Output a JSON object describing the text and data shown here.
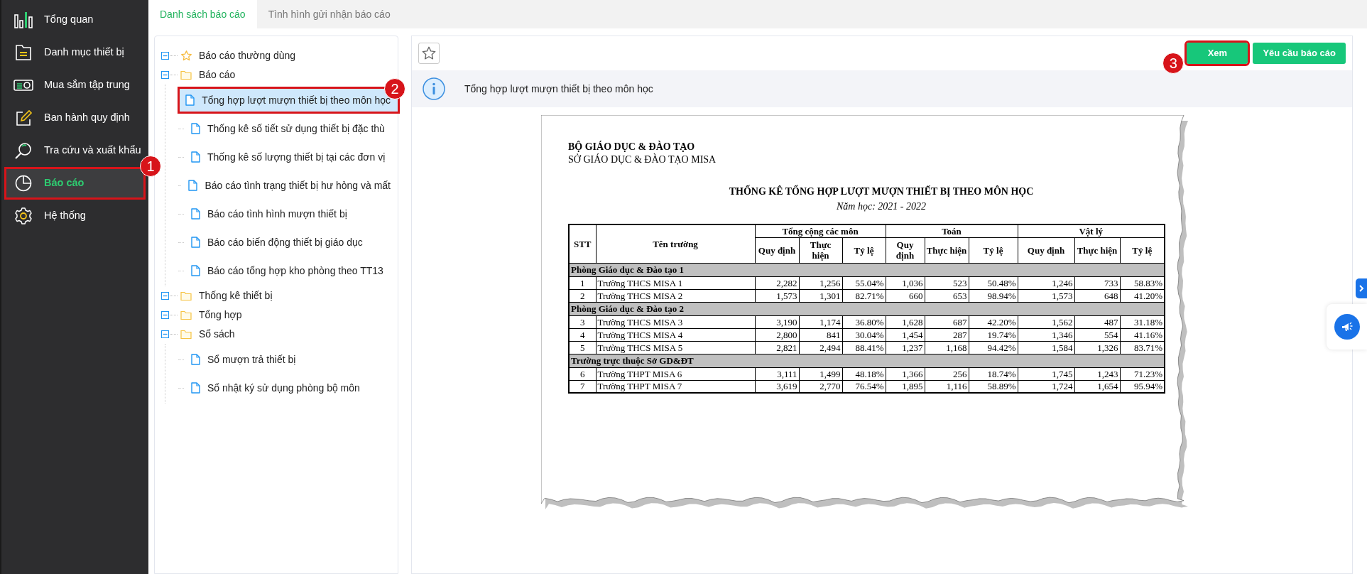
{
  "sidebar": {
    "items": [
      {
        "label": "Tổng quan",
        "selected": false
      },
      {
        "label": "Danh mục thiết bị",
        "selected": false
      },
      {
        "label": "Mua sắm tập trung",
        "selected": false
      },
      {
        "label": "Ban hành quy định",
        "selected": false
      },
      {
        "label": "Tra cứu và xuất khẩu",
        "selected": false
      },
      {
        "label": "Báo cáo",
        "selected": true,
        "callout": "1"
      },
      {
        "label": "Hệ thống",
        "selected": false
      }
    ]
  },
  "tabs": [
    {
      "label": "Danh sách báo cáo",
      "selected": true
    },
    {
      "label": "Tình hình gửi nhận báo cáo",
      "selected": false
    }
  ],
  "tree": [
    {
      "label": "Báo cáo thường dùng",
      "kind": "favorites",
      "expanded": true
    },
    {
      "label": "Báo cáo",
      "kind": "folder",
      "expanded": true,
      "children": [
        {
          "label": "Tổng hợp lượt mượn thiết bị theo môn học",
          "selected": true,
          "callout": "2"
        },
        {
          "label": "Thống kê số tiết sử dụng thiết bị đặc thù",
          "selected": false
        },
        {
          "label": "Thống kê số lượng thiết bị tại các đơn vị",
          "selected": false
        },
        {
          "label": "Báo cáo tình trạng thiết bị hư hỏng và mất",
          "selected": false
        },
        {
          "label": "Báo cáo tình hình mượn thiết bị",
          "selected": false
        },
        {
          "label": "Báo cáo biến động thiết bị giáo dục",
          "selected": false
        },
        {
          "label": "Báo cáo tổng hợp kho phòng theo TT13",
          "selected": false
        }
      ]
    },
    {
      "label": "Thống kê thiết bị",
      "kind": "folder",
      "expanded": true
    },
    {
      "label": "Tổng hợp",
      "kind": "folder",
      "expanded": true
    },
    {
      "label": "Sổ sách",
      "kind": "folder",
      "expanded": true,
      "children": [
        {
          "label": "Sổ mượn trả thiết bị",
          "selected": false
        },
        {
          "label": "Sổ nhật ký sử dụng phòng bộ môn",
          "selected": false
        }
      ]
    }
  ],
  "toolbar": {
    "buttons": [
      {
        "label": "Xem",
        "callout": "3"
      },
      {
        "label": "Yêu cầu báo cáo"
      }
    ]
  },
  "info": "Tổng hợp lượt mượn thiết bị theo môn học",
  "report": {
    "ministry": "BỘ GIÁO DỤC & ĐÀO TẠO",
    "department": "SỞ GIÁO DỤC & ĐÀO TẠO MISA",
    "title": "THỐNG KÊ TỔNG HỢP LƯỢT MƯỢN THIẾT BỊ THEO MÔN HỌC",
    "subtitle": "Năm học: 2021 - 2022",
    "columns": {
      "stt": "STT",
      "name": "Tên trường",
      "groups": [
        {
          "label": "Tổng cộng các môn",
          "columns": [
            "Quy định",
            "Thực hiện",
            "Tỷ lệ"
          ]
        },
        {
          "label": "Toán",
          "columns": [
            "Quy định",
            "Thực hiện",
            "Tỷ lệ"
          ]
        },
        {
          "label": "Vật lý",
          "columns": [
            "Quy định",
            "Thực hiện",
            "Tỷ lệ"
          ]
        }
      ]
    },
    "sections": [
      {
        "title": "Phòng Giáo dục & Đào tạo 1",
        "rows": [
          [
            "1",
            "Trường THCS MISA 1",
            "2,282",
            "1,256",
            "55.04%",
            "1,036",
            "523",
            "50.48%",
            "1,246",
            "733",
            "58.83%"
          ],
          [
            "2",
            "Trường THCS MISA 2",
            "1,573",
            "1,301",
            "82.71%",
            "660",
            "653",
            "98.94%",
            "1,573",
            "648",
            "41.20%"
          ]
        ]
      },
      {
        "title": "Phòng Giáo dục & Đào tạo 2",
        "rows": [
          [
            "3",
            "Trường THCS MISA 3",
            "3,190",
            "1,174",
            "36.80%",
            "1,628",
            "687",
            "42.20%",
            "1,562",
            "487",
            "31.18%"
          ],
          [
            "4",
            "Trường THCS MISA 4",
            "2,800",
            "841",
            "30.04%",
            "1,454",
            "287",
            "19.74%",
            "1,346",
            "554",
            "41.16%"
          ],
          [
            "5",
            "Trường THCS MISA 5",
            "2,821",
            "2,494",
            "88.41%",
            "1,237",
            "1,168",
            "94.42%",
            "1,584",
            "1,326",
            "83.71%"
          ]
        ]
      },
      {
        "title": "Trường trực thuộc Sở GD&ĐT",
        "rows": [
          [
            "6",
            "Trường THPT MISA 6",
            "3,111",
            "1,499",
            "48.18%",
            "1,366",
            "256",
            "18.74%",
            "1,745",
            "1,243",
            "71.23%"
          ],
          [
            "7",
            "Trường THPT MISA 7",
            "3,619",
            "2,770",
            "76.54%",
            "1,895",
            "1,116",
            "58.89%",
            "1,724",
            "1,654",
            "95.94%"
          ]
        ]
      }
    ]
  }
}
